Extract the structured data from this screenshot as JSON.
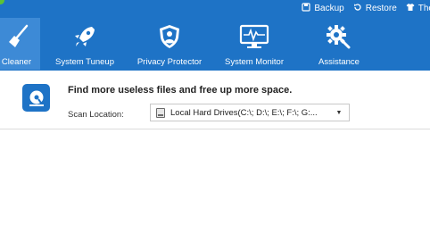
{
  "topbar": {
    "items": [
      {
        "label": "Backup",
        "icon": "backup-icon"
      },
      {
        "label": "Restore",
        "icon": "restore-icon"
      },
      {
        "label": "The",
        "icon": "theme-shirt-icon"
      }
    ]
  },
  "nav": {
    "tabs": [
      {
        "label": "Cleaner",
        "icon": "broom-icon",
        "active": true
      },
      {
        "label": "System Tuneup",
        "icon": "rocket-icon",
        "active": false
      },
      {
        "label": "Privacy Protector",
        "icon": "shield-icon",
        "active": false
      },
      {
        "label": "System Monitor",
        "icon": "monitor-icon",
        "active": false
      },
      {
        "label": "Assistance",
        "icon": "gears-icon",
        "active": false
      }
    ]
  },
  "scan": {
    "title": "Find more useless files and free up more space.",
    "location_label": "Scan Location:",
    "location_value": "Local Hard Drives(C:\\; D:\\; E:\\; F:\\; G:..."
  },
  "colors": {
    "header_blue": "#1e73c6",
    "active_tab": "#3d8ad6",
    "status_green": "#5bc236"
  }
}
